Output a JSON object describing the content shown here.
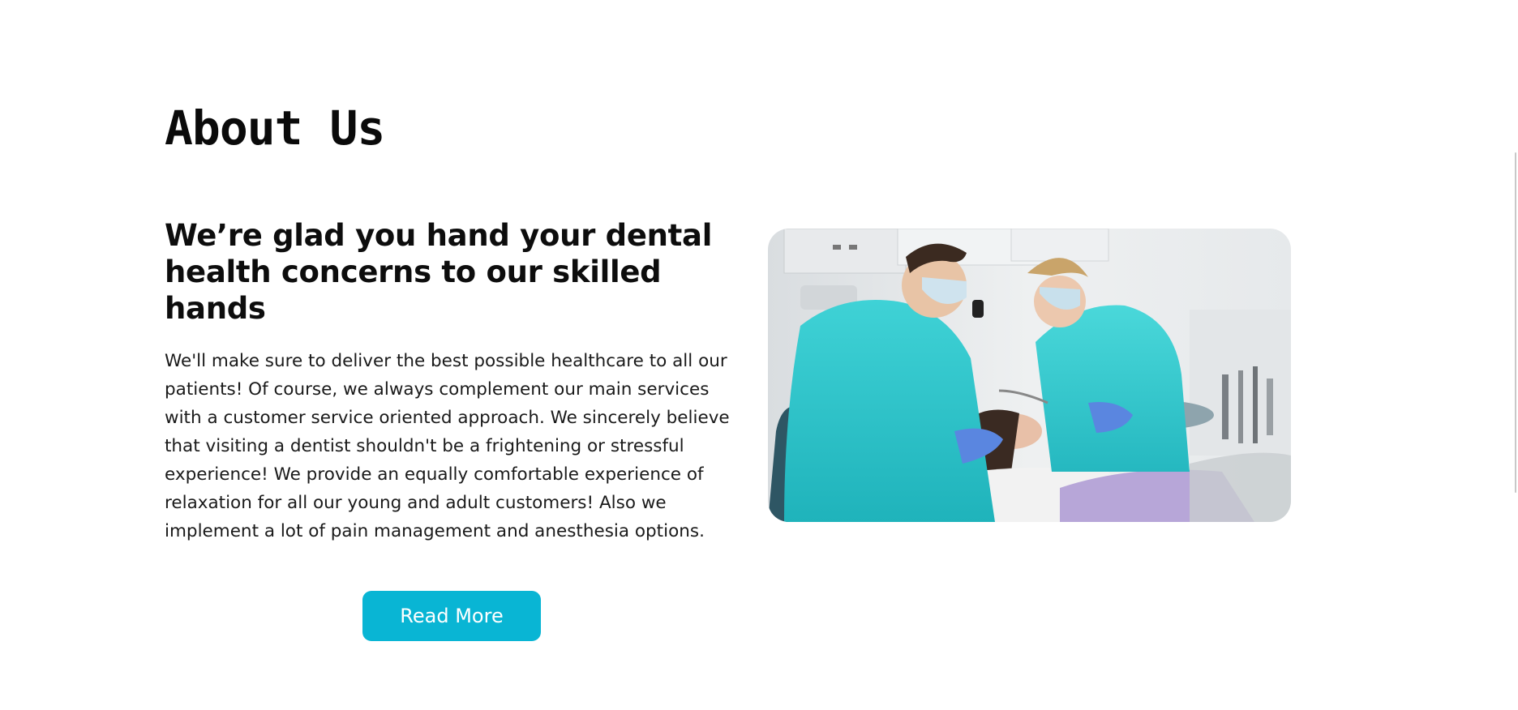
{
  "section": {
    "title": "About Us",
    "heading": "We’re glad you hand your dental health concerns to our skilled hands",
    "description": "We'll make sure to deliver the best possible healthcare to all our patients! Of course, we always complement our main services with a customer service oriented approach. We sincerely believe that visiting a dentist shouldn't be a frightening or stressful experience! We provide an equally comfortable experience of relaxation for all our young and adult customers! Also we implement a lot of pain management and anesthesia options.",
    "button_label": "Read More"
  },
  "image": {
    "alt": "Dentist and assistant treating a patient",
    "icon": "dental-treatment-photo"
  },
  "colors": {
    "accent": "#09b5d4",
    "text": "#111111",
    "background": "#ffffff"
  }
}
